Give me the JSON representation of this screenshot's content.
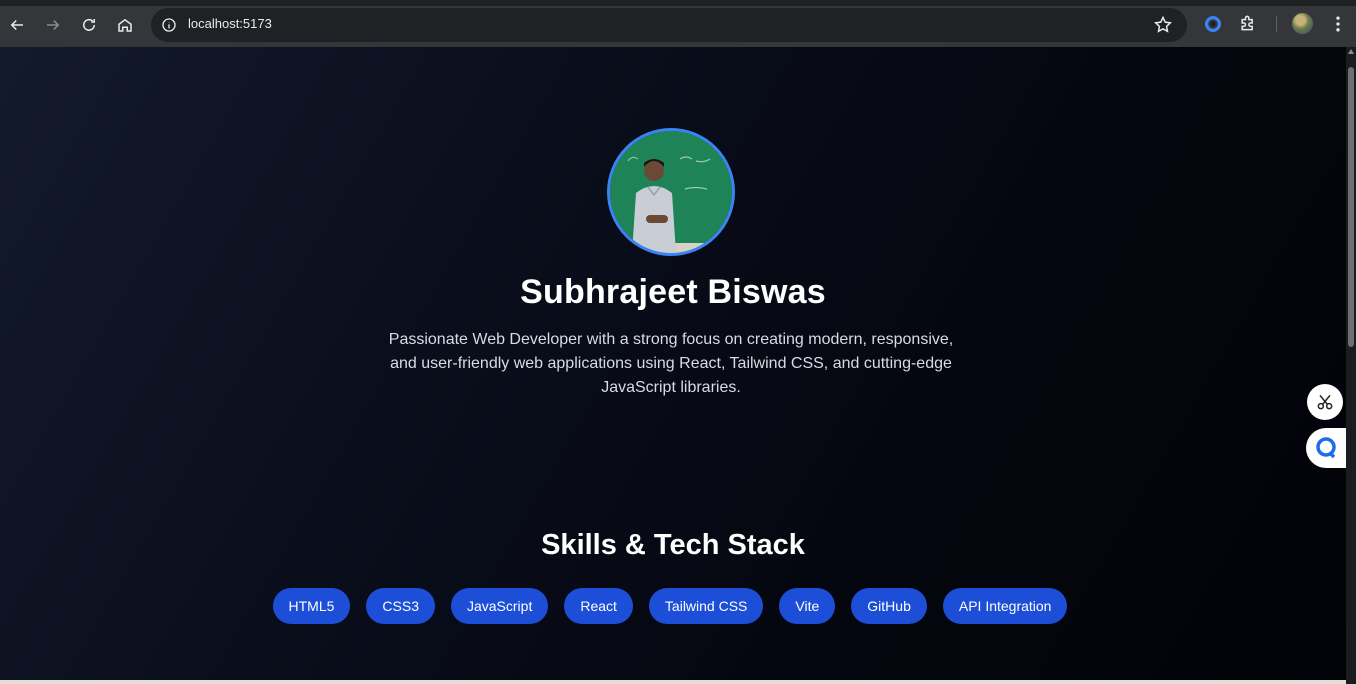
{
  "browser": {
    "url": "localhost:5173"
  },
  "hero": {
    "name": "Subhrajeet Biswas",
    "bio": "Passionate Web Developer with a strong focus on creating modern, responsive, and user-friendly web applications using React, Tailwind CSS, and cutting-edge JavaScript libraries."
  },
  "skills": {
    "title": "Skills & Tech Stack",
    "items": [
      "HTML5",
      "CSS3",
      "JavaScript",
      "React",
      "Tailwind CSS",
      "Vite",
      "GitHub",
      "API Integration"
    ]
  },
  "colors": {
    "accent": "#1d4ed8",
    "ring": "#3b82f6"
  },
  "icons": [
    "back-icon",
    "forward-icon",
    "reload-icon",
    "home-icon",
    "site-info-icon",
    "bookmark-star-icon",
    "extension-ring-icon",
    "puzzle-icon",
    "profile-avatar",
    "kebab-menu-icon",
    "scissors-icon",
    "chat-bubble-icon"
  ]
}
